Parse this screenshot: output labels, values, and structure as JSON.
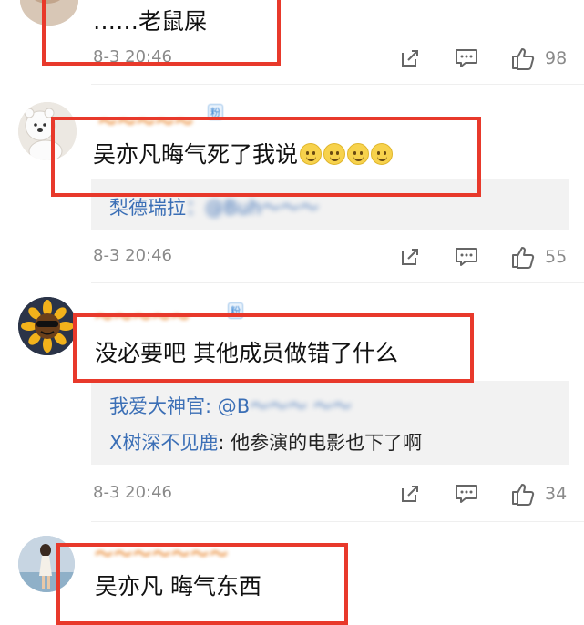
{
  "comments": [
    {
      "text": "……老鼠屎",
      "time": "8-3 20:46",
      "likes": "98"
    },
    {
      "text": "吴亦凡晦气死了我说",
      "emoji_count": 4,
      "reply_name": "梨德瑞拉",
      "time": "8-3 20:46",
      "likes": "55"
    },
    {
      "text": "没必要吧 其他成员做错了什么",
      "replies": [
        {
          "name": "我爱大神官",
          "text": "@B"
        },
        {
          "name": "X树深不见鹿",
          "text": "他参演的电影也下了啊"
        }
      ],
      "time": "8-3 20:46",
      "likes": "34"
    },
    {
      "text": "吴亦凡 晦气东西"
    }
  ],
  "badges": [
    "粉",
    "粉"
  ],
  "colors": {
    "highlight": "#e8392b",
    "link": "#3b6fb6",
    "meta": "#8a8a8a",
    "reply_bg": "#f2f2f2"
  },
  "icons": [
    "share-icon",
    "comment-icon",
    "like-icon"
  ]
}
